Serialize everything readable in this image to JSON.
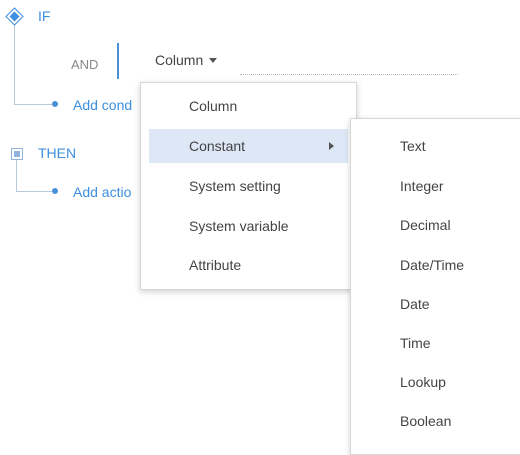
{
  "tree": {
    "if_label": "IF",
    "and_label": "AND",
    "column_trigger": "Column",
    "add_condition": "Add cond",
    "then_label": "THEN",
    "add_action": "Add actio"
  },
  "menu": {
    "items": [
      {
        "label": "Column"
      },
      {
        "label": "Constant",
        "active": true,
        "has_submenu": true
      },
      {
        "label": "System setting"
      },
      {
        "label": "System variable"
      },
      {
        "label": "Attribute"
      }
    ]
  },
  "submenu": {
    "items": [
      {
        "label": "Text"
      },
      {
        "label": "Integer"
      },
      {
        "label": "Decimal"
      },
      {
        "label": "Date/Time"
      },
      {
        "label": "Date"
      },
      {
        "label": "Time"
      },
      {
        "label": "Lookup"
      },
      {
        "label": "Boolean"
      }
    ]
  },
  "colors": {
    "accent": "#3d8fe0",
    "highlight": "#dde7f6",
    "tree_line": "#b7c9db"
  },
  "icons": {
    "if": "diamond-icon",
    "then": "square-icon",
    "caret": "caret-down-icon",
    "submenu_arrow": "chevron-right-icon"
  }
}
